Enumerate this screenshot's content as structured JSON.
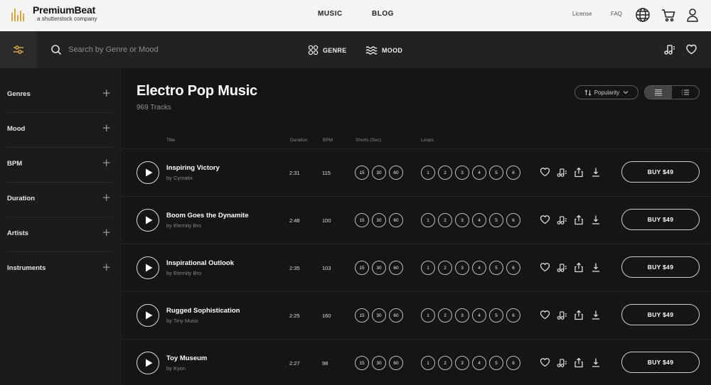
{
  "brand": {
    "name": "PremiumBeat",
    "tagline": "a shutterstock company",
    "color": "#d9a63a"
  },
  "topnav": {
    "links": [
      "MUSIC",
      "BLOG"
    ],
    "license": "License",
    "faq": "FAQ"
  },
  "search": {
    "placeholder": "Search by Genre or Mood",
    "genre_label": "GENRE",
    "mood_label": "MOOD"
  },
  "sidebar": {
    "items": [
      {
        "label": "Genres"
      },
      {
        "label": "Mood"
      },
      {
        "label": "BPM"
      },
      {
        "label": "Duration"
      },
      {
        "label": "Artists"
      },
      {
        "label": "Instruments"
      }
    ]
  },
  "page": {
    "title": "Electro Pop Music",
    "count": "969 Tracks",
    "sort_label": "Popularity"
  },
  "columns": {
    "title": "Title",
    "duration": "Duration",
    "bpm": "BPM",
    "shorts": "Shorts (Sec)",
    "loops": "Loops"
  },
  "shorts": [
    "15",
    "30",
    "60"
  ],
  "loops": [
    "1",
    "2",
    "3",
    "4",
    "5",
    "6"
  ],
  "tracks": [
    {
      "title": "Inspiring Victory",
      "artist": "by Cymatix",
      "duration": "2:31",
      "bpm": "115",
      "buy": "BUY $49"
    },
    {
      "title": "Boom Goes the Dynamite",
      "artist": "by Eternity Bro",
      "duration": "2:48",
      "bpm": "100",
      "buy": "BUY $49"
    },
    {
      "title": "Inspirational Outlook",
      "artist": "by Eternity Bro",
      "duration": "2:35",
      "bpm": "103",
      "buy": "BUY $49"
    },
    {
      "title": "Rugged Sophistication",
      "artist": "by Tiny Music",
      "duration": "2:25",
      "bpm": "160",
      "buy": "BUY $49"
    },
    {
      "title": "Toy Museum",
      "artist": "by Kyon",
      "duration": "2:27",
      "bpm": "98",
      "buy": "BUY $49"
    }
  ]
}
